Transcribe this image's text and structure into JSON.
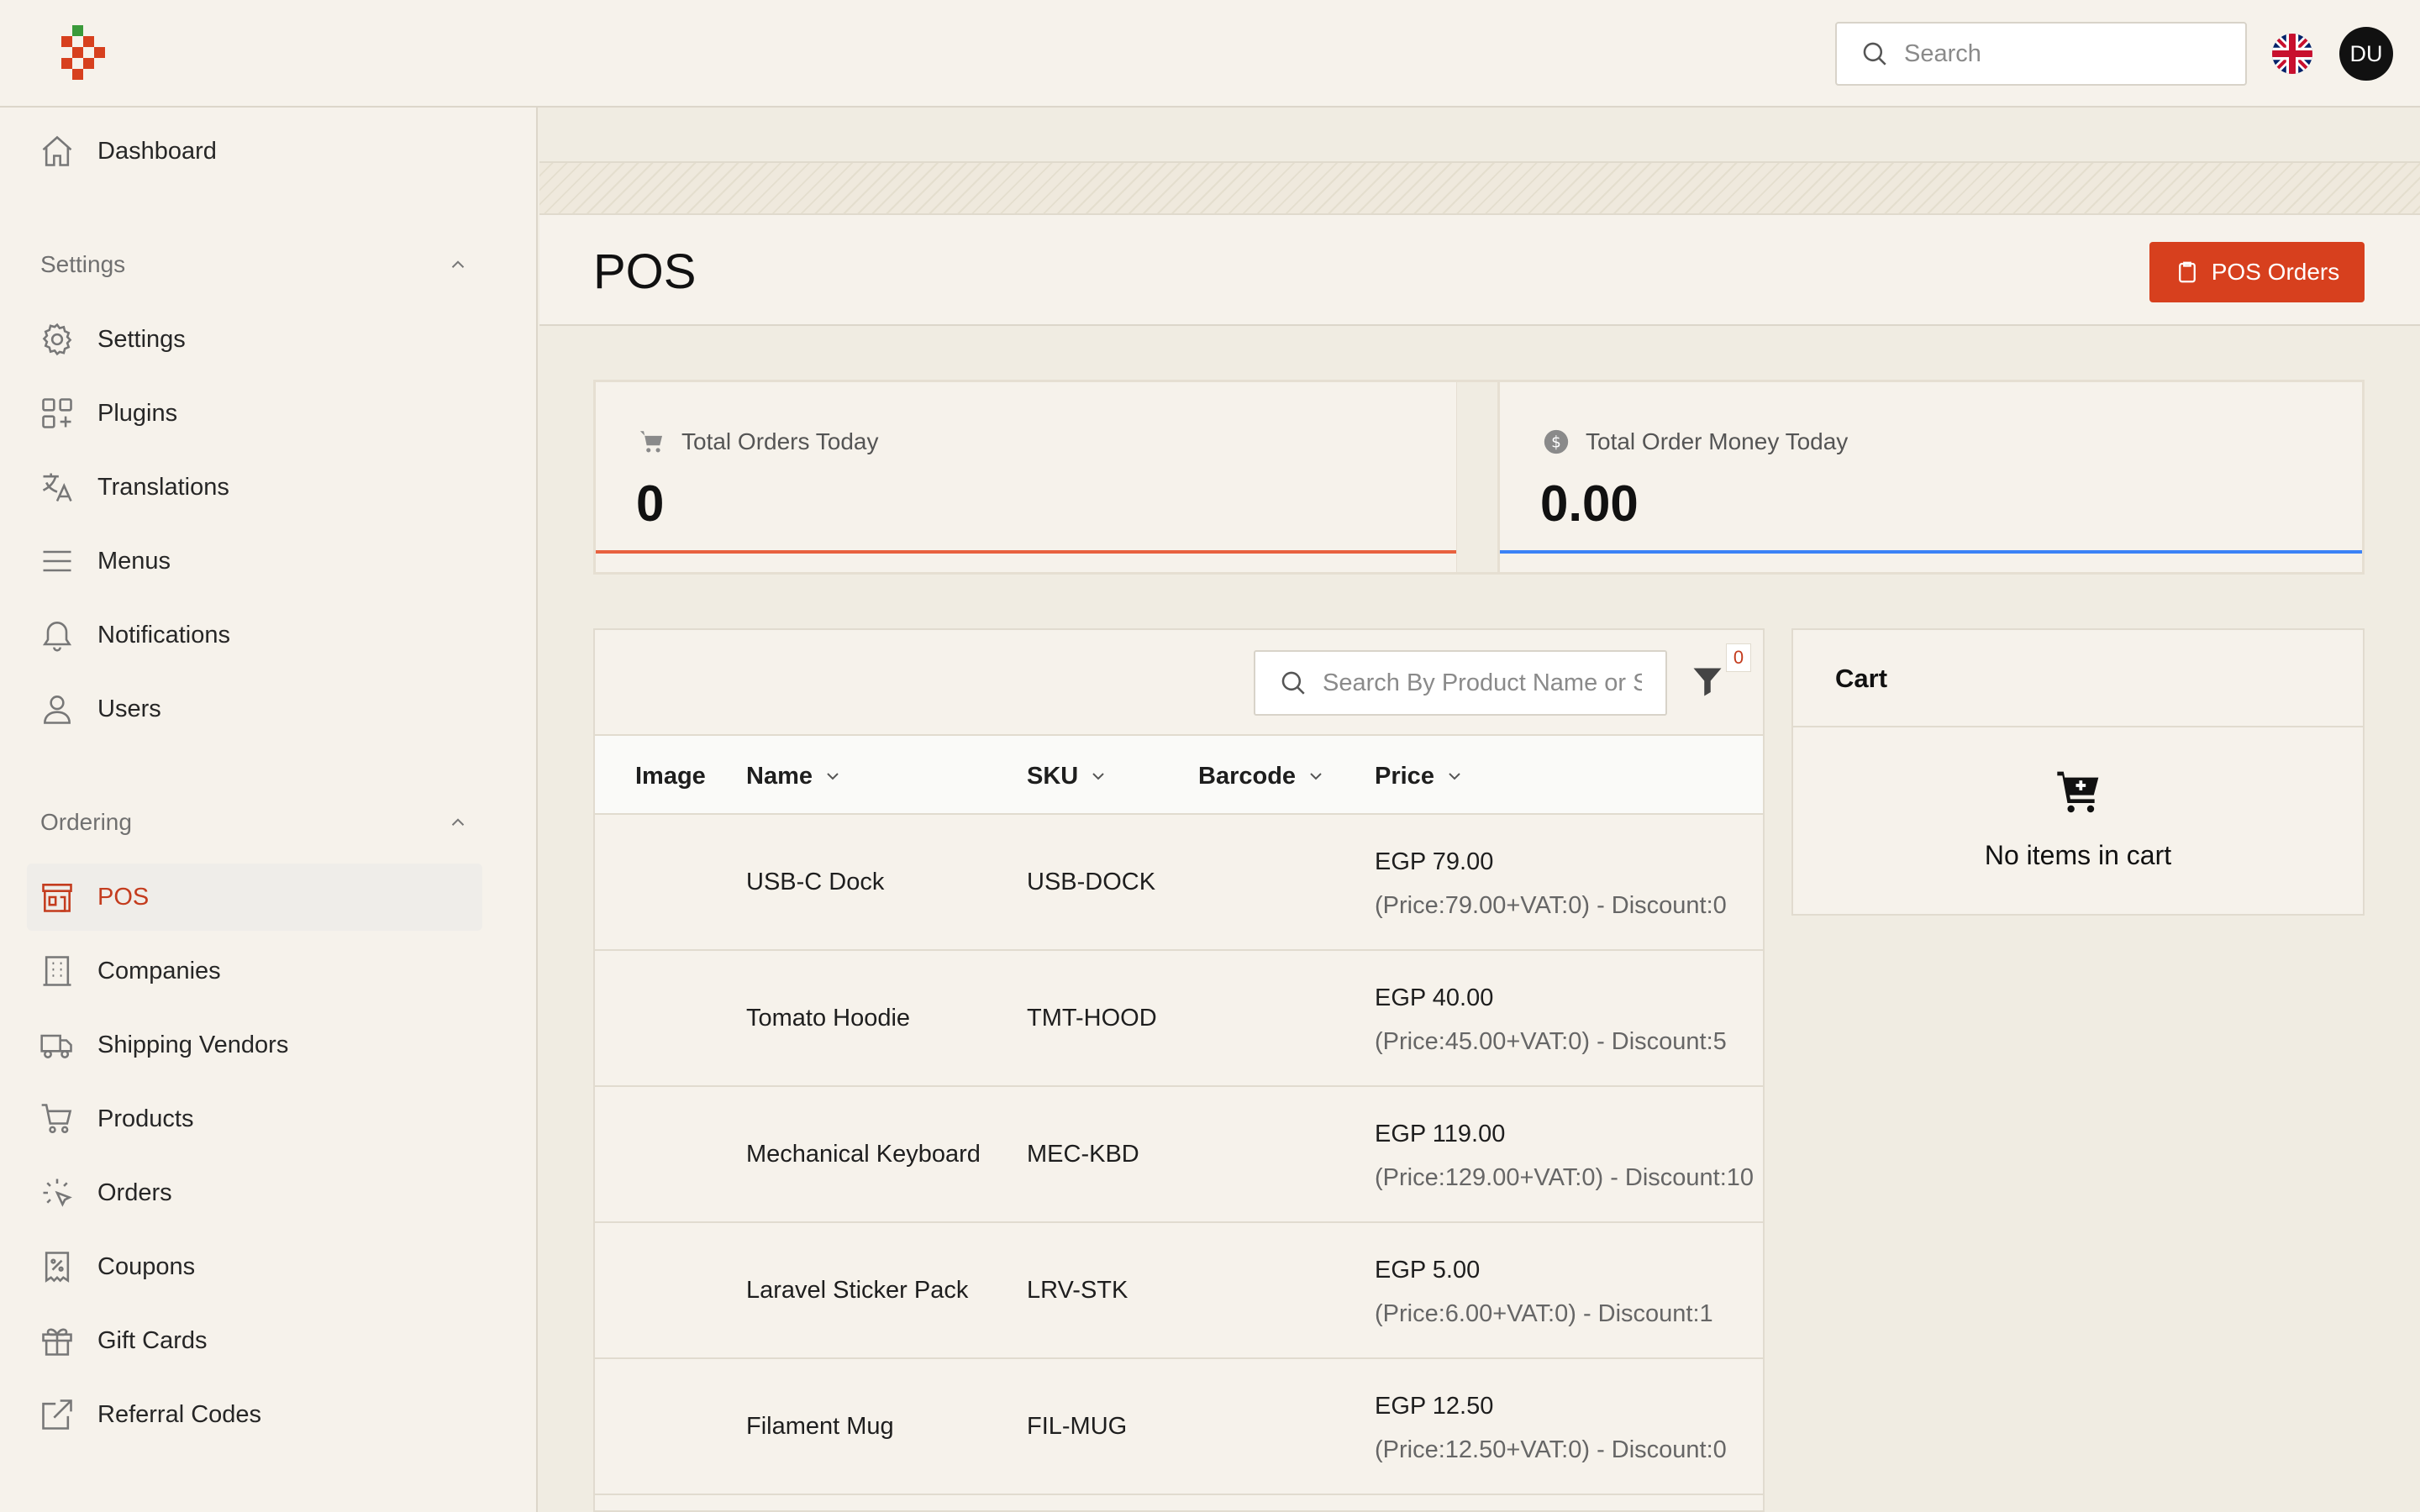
{
  "header": {
    "search_placeholder": "Search",
    "avatar_initials": "DU",
    "locale_flag": "uk-flag-icon"
  },
  "sidebar": {
    "top_items": [
      {
        "label": "Dashboard",
        "icon": "home-icon"
      }
    ],
    "groups": [
      {
        "label": "Settings",
        "items": [
          {
            "label": "Settings",
            "icon": "gear-icon"
          },
          {
            "label": "Plugins",
            "icon": "puzzle-grid-icon"
          },
          {
            "label": "Translations",
            "icon": "translate-icon"
          },
          {
            "label": "Menus",
            "icon": "menu-lines-icon"
          },
          {
            "label": "Notifications",
            "icon": "bell-icon"
          },
          {
            "label": "Users",
            "icon": "user-icon"
          }
        ]
      },
      {
        "label": "Ordering",
        "items": [
          {
            "label": "POS",
            "icon": "storefront-icon",
            "active": true
          },
          {
            "label": "Companies",
            "icon": "building-icon"
          },
          {
            "label": "Shipping Vendors",
            "icon": "truck-icon"
          },
          {
            "label": "Products",
            "icon": "cart-icon"
          },
          {
            "label": "Orders",
            "icon": "cursor-click-icon"
          },
          {
            "label": "Coupons",
            "icon": "receipt-percent-icon"
          },
          {
            "label": "Gift Cards",
            "icon": "gift-icon"
          },
          {
            "label": "Referral Codes",
            "icon": "external-link-icon"
          }
        ]
      }
    ]
  },
  "page": {
    "title": "POS",
    "pos_orders_label": "POS Orders"
  },
  "stats": [
    {
      "label": "Total Orders Today",
      "value": "0",
      "icon": "cart-icon",
      "accent": "#e8613f"
    },
    {
      "label": "Total Order Money Today",
      "value": "0.00",
      "icon": "dollar-circle-icon",
      "accent": "#3b82f6"
    }
  ],
  "products": {
    "search_placeholder": "Search By Product Name or SKU",
    "filter_count": "0",
    "columns": [
      "Image",
      "Name",
      "SKU",
      "Barcode",
      "Price"
    ],
    "rows": [
      {
        "name": "USB-C Dock",
        "sku": "USB-DOCK",
        "barcode": "",
        "price": "EGP 79.00",
        "detail": "(Price:79.00+VAT:0) - Discount:0"
      },
      {
        "name": "Tomato Hoodie",
        "sku": "TMT-HOOD",
        "barcode": "",
        "price": "EGP 40.00",
        "detail": "(Price:45.00+VAT:0) - Discount:5"
      },
      {
        "name": "Mechanical Keyboard",
        "sku": "MEC-KBD",
        "barcode": "",
        "price": "EGP 119.00",
        "detail": "(Price:129.00+VAT:0) - Discount:10"
      },
      {
        "name": "Laravel Sticker Pack",
        "sku": "LRV-STK",
        "barcode": "",
        "price": "EGP 5.00",
        "detail": "(Price:6.00+VAT:0) - Discount:1"
      },
      {
        "name": "Filament Mug",
        "sku": "FIL-MUG",
        "barcode": "",
        "price": "EGP 12.50",
        "detail": "(Price:12.50+VAT:0) - Discount:0"
      }
    ]
  },
  "cart": {
    "title": "Cart",
    "empty_text": "No items in cart"
  },
  "colors": {
    "brand": "#d7401e",
    "active_text": "#c43c1e",
    "background": "#f0ece2",
    "surface": "#f6f2eb"
  }
}
